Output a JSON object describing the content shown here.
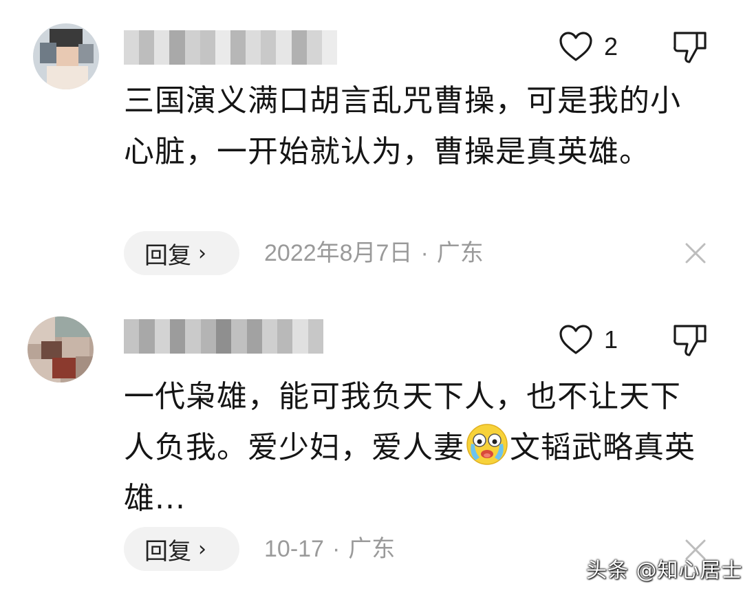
{
  "comments": [
    {
      "like_count": "2",
      "text": "三国演义满口胡言乱咒曹操，可是我的小心脏，一开始就认为，曹操是真英雄。",
      "reply_label": "回复",
      "reply_chevron": "›",
      "date": "2022年8月7日",
      "separator": "·",
      "location": "广东"
    },
    {
      "like_count": "1",
      "text_before_emoji": "一代枭雄，能可我负天下人，也不让天下人负我。爱少妇，爱人妻",
      "emoji": "crying-laughing-emoji",
      "text_after_emoji": "文韬武略真英雄...",
      "reply_label": "回复",
      "reply_chevron": "›",
      "date": "10-17",
      "separator": "·",
      "location": "广东"
    }
  ],
  "watermark": "头条 @知心居士",
  "icons": {
    "like": "heart-outline-icon",
    "dislike": "thumbs-down-outline-icon",
    "close": "close-x-icon"
  },
  "colors": {
    "text": "#151515",
    "meta": "#9a9a9a",
    "reply_bg": "#f2f2f2",
    "icon": "#1a1a1a",
    "close": "#bdbdbd"
  }
}
